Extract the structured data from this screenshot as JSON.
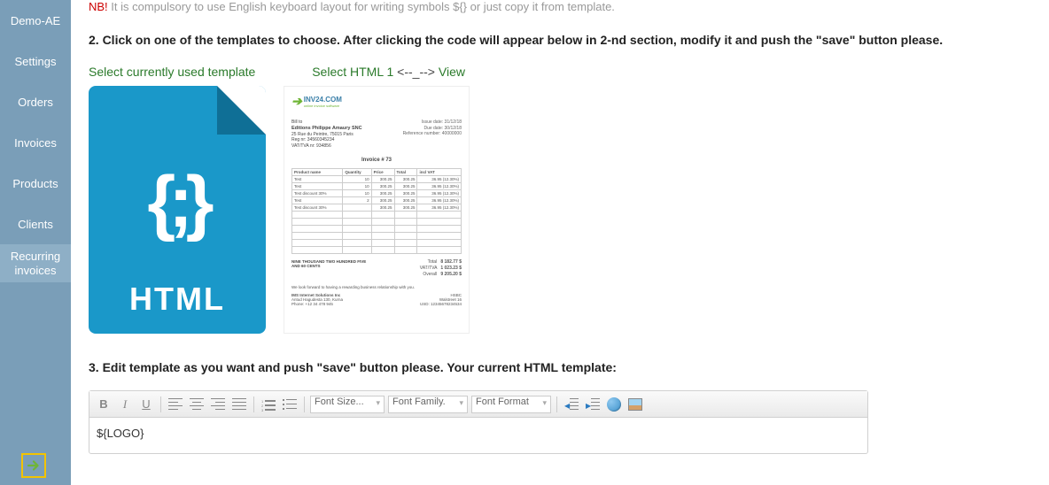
{
  "sidebar": {
    "items": [
      {
        "label": "Demo-AE"
      },
      {
        "label": "Settings"
      },
      {
        "label": "Orders"
      },
      {
        "label": "Invoices"
      },
      {
        "label": "Products"
      },
      {
        "label": "Clients"
      },
      {
        "label": "Recurring invoices"
      }
    ]
  },
  "nb": {
    "prefix": "NB!",
    "text": " It is compulsory to use English keyboard layout for writing symbols ${} or just copy it from template."
  },
  "step2": "2. Click on one of the templates to choose. After clicking the code will appear below in 2-nd section, modify it and push the \"save\" button please.",
  "links": {
    "current": "Select currently used template",
    "html1_a": "Select HTML 1",
    "html1_mid": " <--_--> ",
    "html1_b": "View"
  },
  "doc": {
    "braces": "{;}",
    "label": "HTML"
  },
  "preview": {
    "brand": "INV24.COM",
    "brand_sub": "online invoice software",
    "to_title": "Editions Philippe Amaury SNC",
    "to_l1": "25 Rue du Peintre, 75015 Paris",
    "to_l2": "Reg nr: 34560345234",
    "to_l3": "VAT/TVA nr: 934856",
    "meta_l1": "Issue date: 31/12/18",
    "meta_l2": "Due date: 30/12/18",
    "meta_l3": "Reference number: 40000000",
    "title": "Invoice # 73",
    "cols": [
      "Product name",
      "Quantity",
      "Price",
      "Total",
      "incl VAT"
    ],
    "rows": [
      [
        "Test",
        "10",
        "300.25",
        "300.25",
        "36.95 (12.30%)"
      ],
      [
        "Test",
        "10",
        "300.25",
        "300.25",
        "36.95 (12.30%)"
      ],
      [
        "Test discount 30%",
        "10",
        "300.25",
        "300.25",
        "36.95 (12.30%)"
      ],
      [
        "Test",
        "2",
        "300.25",
        "300.25",
        "36.95 (12.30%)"
      ],
      [
        "Test discount 30%",
        "",
        "300.25",
        "300.25",
        "36.95 (12.30%)"
      ]
    ],
    "words": "NINE THOUSAND TWO HUNDRED FIVE AND 60 CENTS",
    "sum_lbls": [
      "Total",
      "VAT/TVA",
      "Overall"
    ],
    "sum_vals": [
      "8 182.77 $",
      "1 023.23 $",
      "9 205.20 $"
    ],
    "foot_note": "We look forward to having a rewarding business relationship with you.",
    "foot_left": [
      "IMS Internet Solutions Inc",
      "Antud Hagudesta 130, Kurna",
      "Phone: +12 34 478 945"
    ],
    "foot_right": [
      "HSBC",
      "Walstreet 16",
      "USD: 12345678234534"
    ]
  },
  "step3": "3. Edit template as you want and push \"save\" button please. Your current HTML template:",
  "toolbar": {
    "bold": "B",
    "italic": "I",
    "under": "U",
    "font_size": "Font Size...",
    "font_family": "Font Family.",
    "font_format": "Font Format"
  },
  "editor_content": "${LOGO}"
}
